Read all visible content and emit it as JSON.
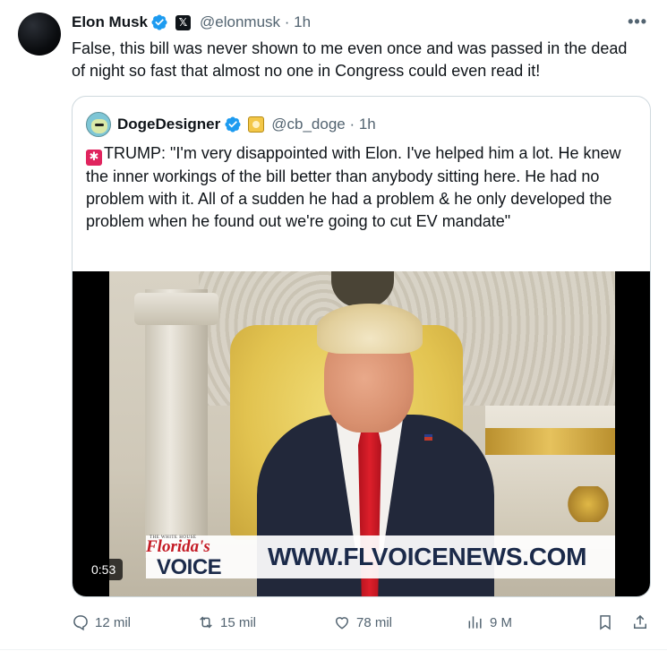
{
  "tweet": {
    "author_name": "Elon Musk",
    "handle_time": "@elonmusk · 1h",
    "text": "False, this bill was never shown to me even once and was passed in the dead of night so fast that almost no one in Congress could even read it!",
    "more_icon": "more-icon",
    "verified_color": "#1d9bf0"
  },
  "quote": {
    "author_name": "DogeDesigner",
    "handle_time": "@cb_doge · 1h",
    "text": "TRUMP: \"I'm very disappointed with Elon. I've helped him a lot. He knew the inner workings of the bill better than anybody sitting here. He had no problem with it. All of a sudden he had a problem & he only developed the problem when he found out we're going to cut EV mandate\"",
    "video": {
      "duration": "0:53",
      "lower_third_small": "THE WHITE HOUSE",
      "brand_line1": "Florida's",
      "brand_line2": "VOICE",
      "url": "WWW.FLVOICENEWS.COM"
    }
  },
  "actions": {
    "replies": "12 mil",
    "reposts": "15 mil",
    "likes": "78 mil",
    "views": "9 M"
  }
}
